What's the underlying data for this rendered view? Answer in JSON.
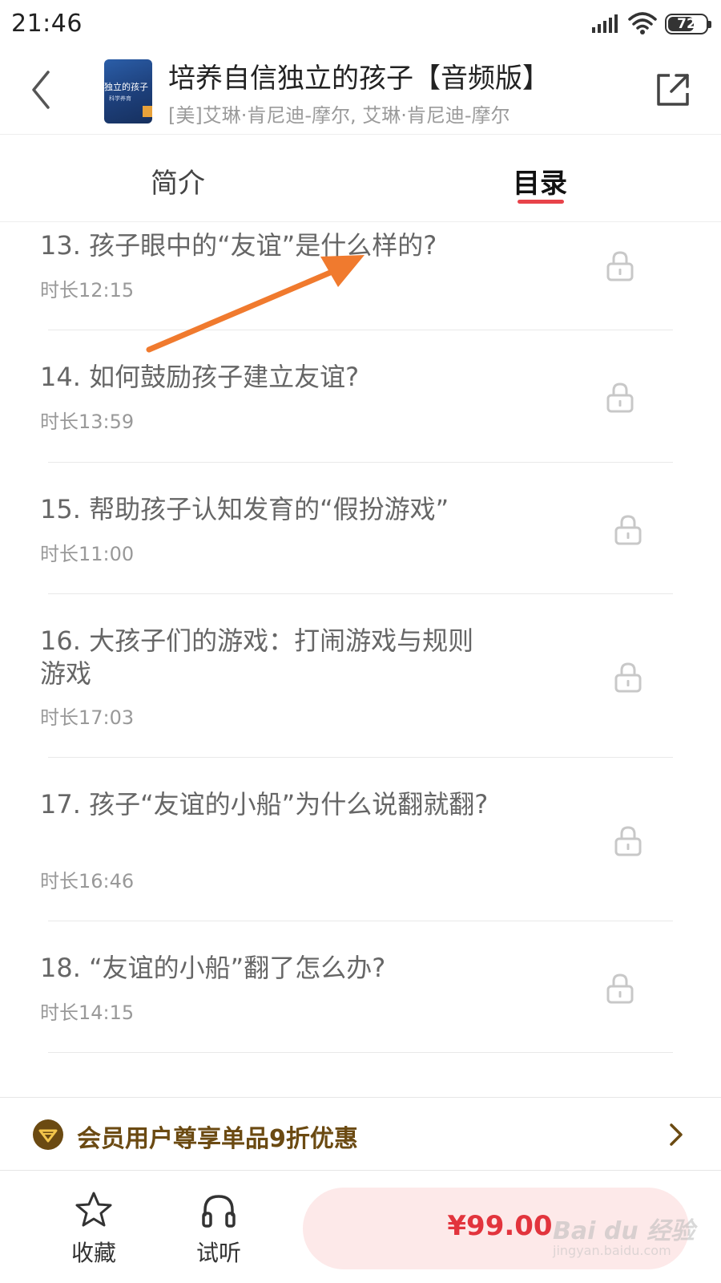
{
  "status_bar": {
    "time": "21:46",
    "battery": "72",
    "battery_level": 0.72
  },
  "header": {
    "cover_title": "独立的孩子",
    "cover_sub": "科学养育",
    "title": "培养自信独立的孩子【音频版】",
    "author": "[美]艾琳·肯尼迪-摩尔, 艾琳·肯尼迪-摩尔"
  },
  "tabs": [
    {
      "label": "简介",
      "active": false
    },
    {
      "label": "目录",
      "active": true
    }
  ],
  "chapters": [
    {
      "title": "13. 孩子眼中的“友谊”是什么样的?",
      "duration": "时长12:15",
      "locked": true
    },
    {
      "title": "14. 如何鼓励孩子建立友谊?",
      "duration": "时长13:59",
      "locked": true
    },
    {
      "title": "15. 帮助孩子认知发育的“假扮游戏”",
      "duration": "时长11:00",
      "locked": true
    },
    {
      "title": "16. 大孩子们的游戏：打闹游戏与规则游戏",
      "duration": "时长17:03",
      "locked": true
    },
    {
      "title": "17. 孩子“友谊的小船”为什么说翻就翻?",
      "duration": "时长16:46",
      "locked": true
    },
    {
      "title": "18. “友谊的小船”翻了怎么办?",
      "duration": "时长14:15",
      "locked": true
    }
  ],
  "member_banner": {
    "text": "会员用户尊享单品9折优惠"
  },
  "bottom_bar": {
    "favorite_label": "收藏",
    "listen_label": "试听",
    "price": "¥99.00"
  },
  "watermark": {
    "text": "Bai du 经验",
    "sub": "jingyan.baidu.com"
  },
  "colors": {
    "accent": "#e8434a",
    "price": "#e2343d",
    "member_gold": "#6b4a12",
    "arrow": "#f07a2e"
  },
  "icons": [
    "back-icon",
    "share-icon",
    "lock-icon",
    "member-icon",
    "chevron-right-icon",
    "star-icon",
    "headphones-icon",
    "signal-icon",
    "wifi-icon"
  ]
}
